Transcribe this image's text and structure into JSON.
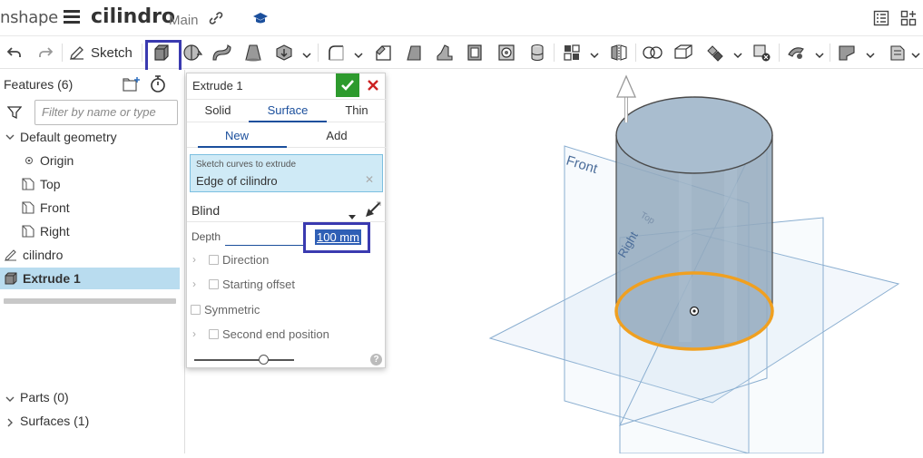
{
  "header": {
    "logo_text": "nshape",
    "document_name": "cilindro",
    "branch": "Main"
  },
  "toolbar": {
    "sketch_label": "Sketch"
  },
  "feature_tree": {
    "title": "Features (6)",
    "filter_placeholder": "Filter by name or type",
    "default_geometry": "Default geometry",
    "items": [
      {
        "label": "Origin"
      },
      {
        "label": "Top"
      },
      {
        "label": "Front"
      },
      {
        "label": "Right"
      },
      {
        "label": "cilindro"
      },
      {
        "label": "Extrude 1"
      }
    ],
    "parts": "Parts (0)",
    "surfaces": "Surfaces (1)"
  },
  "extrude_panel": {
    "title": "Extrude 1",
    "tabs": [
      "Solid",
      "Surface",
      "Thin"
    ],
    "active_tab": "Surface",
    "subtabs": [
      "New",
      "Add"
    ],
    "active_subtab": "New",
    "query_label": "Sketch curves to extrude",
    "query_value": "Edge of cilindro",
    "end_type": "Blind",
    "depth_label": "Depth",
    "depth_value": "100 mm",
    "options": {
      "direction": "Direction",
      "starting_offset": "Starting offset",
      "symmetric": "Symmetric",
      "second_end": "Second end position"
    },
    "help": "?"
  },
  "viewport": {
    "plane_front": "Front",
    "plane_right": "Right",
    "plane_top": "Top"
  },
  "colors": {
    "accent": "#1b4f9c",
    "highlight_box": "#3a3ab0",
    "ok_green": "#2d9a2d",
    "cancel_red": "#cc2222",
    "selected_edge": "#f0a020",
    "plane": "#8aaed0"
  }
}
